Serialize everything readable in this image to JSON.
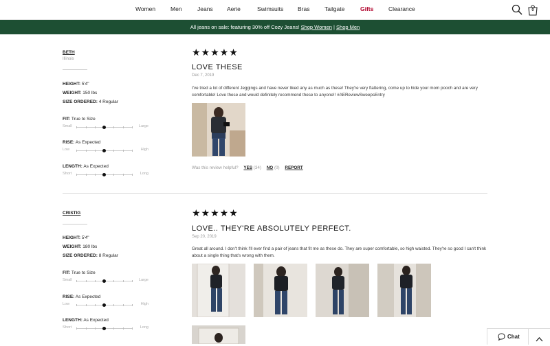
{
  "nav": {
    "items": [
      {
        "label": "Women"
      },
      {
        "label": "Men"
      },
      {
        "label": "Jeans"
      },
      {
        "label": "Aerie"
      },
      {
        "label": "Swimsuits"
      },
      {
        "label": "Bras"
      },
      {
        "label": "Tailgate"
      },
      {
        "label": "Gifts"
      },
      {
        "label": "Clearance"
      }
    ],
    "bag_count": "0",
    "icons": {
      "search": "search-icon",
      "bag": "shopping-bag-icon"
    }
  },
  "banner": {
    "text": "All jeans on sale: featuring 30% off Cozy Jeans!",
    "link_women": "Shop Women",
    "separator": "|",
    "link_men": "Shop Men"
  },
  "reviews": [
    {
      "name": "BETH",
      "location": "Illinois",
      "height_label": "HEIGHT:",
      "height": "5'4\"",
      "weight_label": "WEIGHT:",
      "weight": "150 lbs",
      "size_label": "SIZE ORDERED:",
      "size": "4 Regular",
      "fit_label": "FIT:",
      "fit": "True to Size",
      "fit_lo": "Small",
      "fit_hi": "Large",
      "fit_level": 0.5,
      "rise_label": "RISE:",
      "rise": "As Expected",
      "rise_lo": "Low",
      "rise_hi": "High",
      "rise_level": 0.5,
      "length_label": "LENGTH:",
      "length": "As Expected",
      "length_lo": "Short",
      "length_hi": "Long",
      "length_level": 0.5,
      "stars": "★★★★★",
      "title": "LOVE THESE",
      "date": "Dec 7, 2019",
      "body": "I've tried a lot of different Jeggings and have never liked any as much as these! They're very flattering, come up to hide your mom pooch and are very comfortable! Love these and would definitely recommend these to anyone!! #AEReviewSweepsEntry",
      "helpful_prompt": "Was this review helpful?",
      "yes": "YES",
      "yes_count": "(34)",
      "no": "NO",
      "no_count": "(0)",
      "report": "REPORT"
    },
    {
      "name": "CRISTIG",
      "height_label": "HEIGHT:",
      "height": "5'4\"",
      "weight_label": "WEIGHT:",
      "weight": "180 lbs",
      "size_label": "SIZE ORDERED:",
      "size": "8 Regular",
      "fit_label": "FIT:",
      "fit": "True to Size",
      "fit_lo": "Small",
      "fit_hi": "Large",
      "fit_level": 0.5,
      "rise_label": "RISE:",
      "rise": "As Expected",
      "rise_lo": "Low",
      "rise_hi": "High",
      "rise_level": 0.5,
      "length_label": "LENGTH:",
      "length": "As Expected",
      "length_lo": "Short",
      "length_hi": "Long",
      "length_level": 0.5,
      "stars": "★★★★★",
      "title": "LOVE.. THEY'RE ABSOLUTELY PERFECT.",
      "date": "Sep 20, 2019",
      "body": "Great all around. I don't think I'll ever find a pair of jeans that fit me as these do. They are super comfortable, so high waisted. They're so good I can't think about a single thing that's wrong with them."
    }
  ],
  "chat": {
    "label": "Chat",
    "icon": "chat-bubble-icon"
  },
  "colors": {
    "banner": "#1d4f33",
    "gifts": "#b0002a"
  }
}
